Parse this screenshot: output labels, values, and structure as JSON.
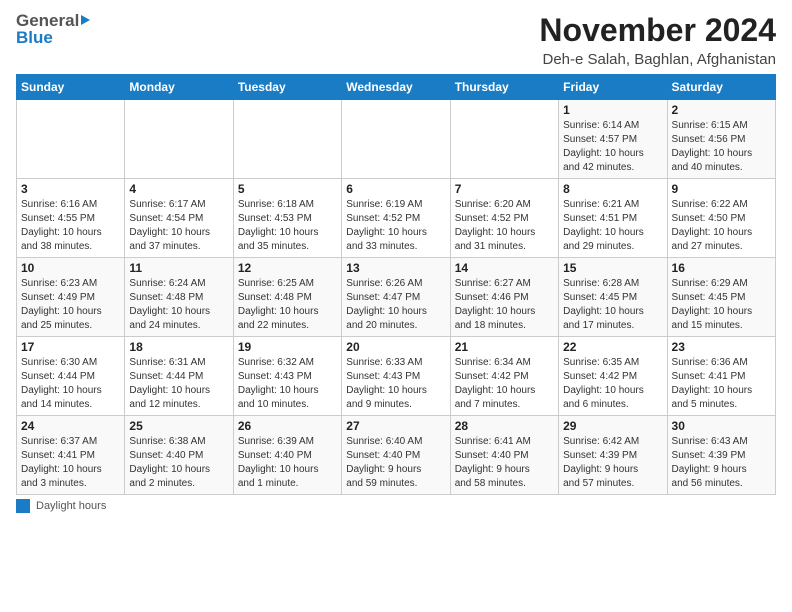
{
  "header": {
    "logo_general": "General",
    "logo_blue": "Blue",
    "main_title": "November 2024",
    "subtitle": "Deh-e Salah, Baghlan, Afghanistan"
  },
  "calendar": {
    "headers": [
      "Sunday",
      "Monday",
      "Tuesday",
      "Wednesday",
      "Thursday",
      "Friday",
      "Saturday"
    ],
    "rows": [
      [
        {
          "day": "",
          "info": ""
        },
        {
          "day": "",
          "info": ""
        },
        {
          "day": "",
          "info": ""
        },
        {
          "day": "",
          "info": ""
        },
        {
          "day": "",
          "info": ""
        },
        {
          "day": "1",
          "info": "Sunrise: 6:14 AM\nSunset: 4:57 PM\nDaylight: 10 hours\nand 42 minutes."
        },
        {
          "day": "2",
          "info": "Sunrise: 6:15 AM\nSunset: 4:56 PM\nDaylight: 10 hours\nand 40 minutes."
        }
      ],
      [
        {
          "day": "3",
          "info": "Sunrise: 6:16 AM\nSunset: 4:55 PM\nDaylight: 10 hours\nand 38 minutes."
        },
        {
          "day": "4",
          "info": "Sunrise: 6:17 AM\nSunset: 4:54 PM\nDaylight: 10 hours\nand 37 minutes."
        },
        {
          "day": "5",
          "info": "Sunrise: 6:18 AM\nSunset: 4:53 PM\nDaylight: 10 hours\nand 35 minutes."
        },
        {
          "day": "6",
          "info": "Sunrise: 6:19 AM\nSunset: 4:52 PM\nDaylight: 10 hours\nand 33 minutes."
        },
        {
          "day": "7",
          "info": "Sunrise: 6:20 AM\nSunset: 4:52 PM\nDaylight: 10 hours\nand 31 minutes."
        },
        {
          "day": "8",
          "info": "Sunrise: 6:21 AM\nSunset: 4:51 PM\nDaylight: 10 hours\nand 29 minutes."
        },
        {
          "day": "9",
          "info": "Sunrise: 6:22 AM\nSunset: 4:50 PM\nDaylight: 10 hours\nand 27 minutes."
        }
      ],
      [
        {
          "day": "10",
          "info": "Sunrise: 6:23 AM\nSunset: 4:49 PM\nDaylight: 10 hours\nand 25 minutes."
        },
        {
          "day": "11",
          "info": "Sunrise: 6:24 AM\nSunset: 4:48 PM\nDaylight: 10 hours\nand 24 minutes."
        },
        {
          "day": "12",
          "info": "Sunrise: 6:25 AM\nSunset: 4:48 PM\nDaylight: 10 hours\nand 22 minutes."
        },
        {
          "day": "13",
          "info": "Sunrise: 6:26 AM\nSunset: 4:47 PM\nDaylight: 10 hours\nand 20 minutes."
        },
        {
          "day": "14",
          "info": "Sunrise: 6:27 AM\nSunset: 4:46 PM\nDaylight: 10 hours\nand 18 minutes."
        },
        {
          "day": "15",
          "info": "Sunrise: 6:28 AM\nSunset: 4:45 PM\nDaylight: 10 hours\nand 17 minutes."
        },
        {
          "day": "16",
          "info": "Sunrise: 6:29 AM\nSunset: 4:45 PM\nDaylight: 10 hours\nand 15 minutes."
        }
      ],
      [
        {
          "day": "17",
          "info": "Sunrise: 6:30 AM\nSunset: 4:44 PM\nDaylight: 10 hours\nand 14 minutes."
        },
        {
          "day": "18",
          "info": "Sunrise: 6:31 AM\nSunset: 4:44 PM\nDaylight: 10 hours\nand 12 minutes."
        },
        {
          "day": "19",
          "info": "Sunrise: 6:32 AM\nSunset: 4:43 PM\nDaylight: 10 hours\nand 10 minutes."
        },
        {
          "day": "20",
          "info": "Sunrise: 6:33 AM\nSunset: 4:43 PM\nDaylight: 10 hours\nand 9 minutes."
        },
        {
          "day": "21",
          "info": "Sunrise: 6:34 AM\nSunset: 4:42 PM\nDaylight: 10 hours\nand 7 minutes."
        },
        {
          "day": "22",
          "info": "Sunrise: 6:35 AM\nSunset: 4:42 PM\nDaylight: 10 hours\nand 6 minutes."
        },
        {
          "day": "23",
          "info": "Sunrise: 6:36 AM\nSunset: 4:41 PM\nDaylight: 10 hours\nand 5 minutes."
        }
      ],
      [
        {
          "day": "24",
          "info": "Sunrise: 6:37 AM\nSunset: 4:41 PM\nDaylight: 10 hours\nand 3 minutes."
        },
        {
          "day": "25",
          "info": "Sunrise: 6:38 AM\nSunset: 4:40 PM\nDaylight: 10 hours\nand 2 minutes."
        },
        {
          "day": "26",
          "info": "Sunrise: 6:39 AM\nSunset: 4:40 PM\nDaylight: 10 hours\nand 1 minute."
        },
        {
          "day": "27",
          "info": "Sunrise: 6:40 AM\nSunset: 4:40 PM\nDaylight: 9 hours\nand 59 minutes."
        },
        {
          "day": "28",
          "info": "Sunrise: 6:41 AM\nSunset: 4:40 PM\nDaylight: 9 hours\nand 58 minutes."
        },
        {
          "day": "29",
          "info": "Sunrise: 6:42 AM\nSunset: 4:39 PM\nDaylight: 9 hours\nand 57 minutes."
        },
        {
          "day": "30",
          "info": "Sunrise: 6:43 AM\nSunset: 4:39 PM\nDaylight: 9 hours\nand 56 minutes."
        }
      ]
    ]
  },
  "footer": {
    "daylight_label": "Daylight hours"
  }
}
